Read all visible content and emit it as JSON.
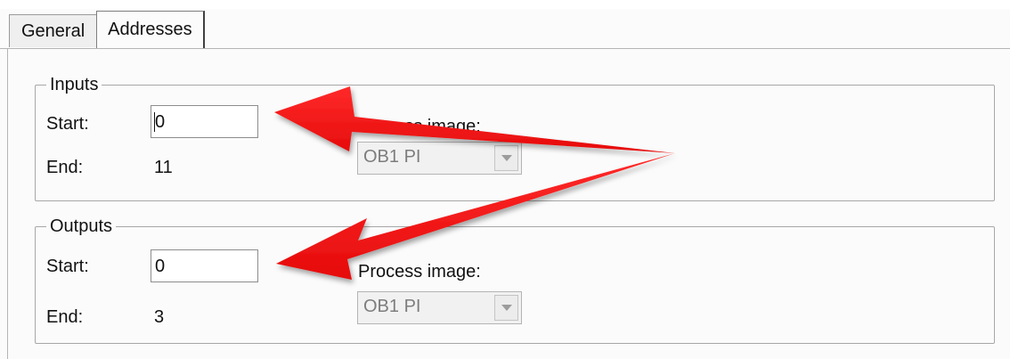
{
  "tabs": [
    {
      "label": "General",
      "active": false
    },
    {
      "label": "Addresses",
      "active": true
    }
  ],
  "inputs": {
    "title": "Inputs",
    "start_label": "Start:",
    "start_value": "0",
    "end_label": "End:",
    "end_value": "11",
    "process_image_label": "Process image:",
    "process_image_value": "OB1 PI"
  },
  "outputs": {
    "title": "Outputs",
    "start_label": "Start:",
    "start_value": "0",
    "end_label": "End:",
    "end_value": "3",
    "process_image_label": "Process image:",
    "process_image_value": "OB1 PI"
  },
  "annotation": {
    "arrow_color": "#ee1111",
    "icon": "red-arrow-icon"
  }
}
